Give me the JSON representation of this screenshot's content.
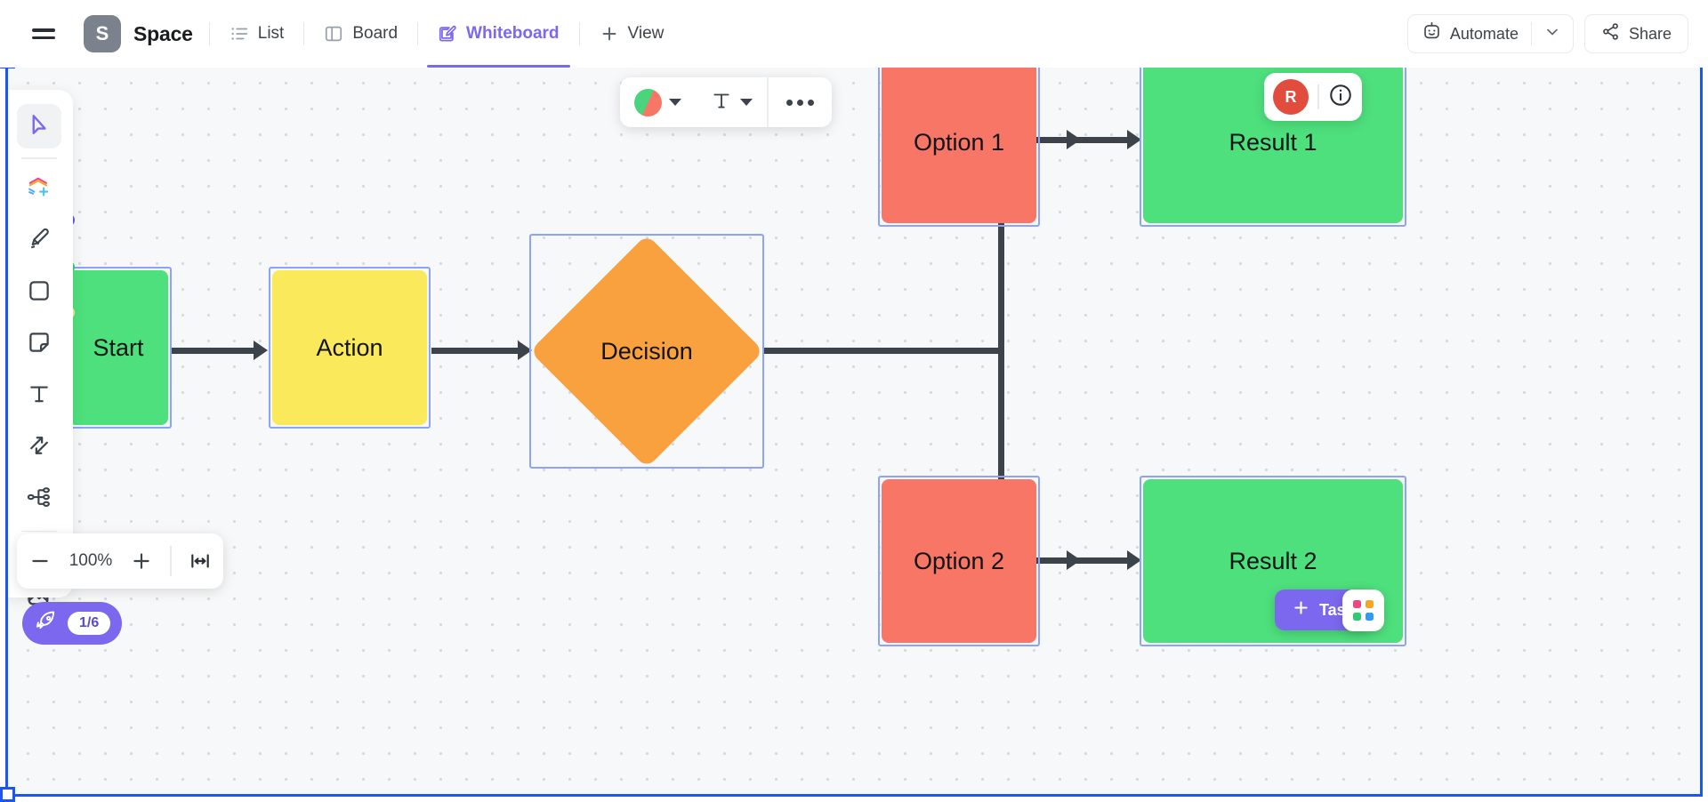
{
  "header": {
    "menu_icon": "hamburger-icon",
    "space_initial": "S",
    "space_name": "Space",
    "tabs": [
      {
        "label": "List",
        "icon": "list-icon",
        "active": false
      },
      {
        "label": "Board",
        "icon": "board-icon",
        "active": false
      },
      {
        "label": "Whiteboard",
        "icon": "whiteboard-icon",
        "active": true
      },
      {
        "label": "View",
        "icon": "plus-icon",
        "active": false
      }
    ],
    "automate_label": "Automate",
    "automate_icon": "robot-icon",
    "automate_caret_icon": "chevron-down-icon",
    "share_label": "Share",
    "share_icon": "share-icon"
  },
  "toolbar": {
    "tools": [
      {
        "name": "select-tool",
        "icon": "cursor-icon",
        "selected": true
      },
      {
        "name": "shapes-add-tool",
        "icon": "layers-plus-icon",
        "selected": false
      },
      {
        "name": "pen-tool",
        "icon": "highlighter-icon",
        "selected": false
      },
      {
        "name": "rectangle-tool",
        "icon": "square-icon",
        "selected": false
      },
      {
        "name": "sticky-note-tool",
        "icon": "sticky-note-icon",
        "selected": false
      },
      {
        "name": "text-tool",
        "icon": "text-t-icon",
        "selected": false
      },
      {
        "name": "connector-tool",
        "icon": "arrows-icon",
        "selected": false
      },
      {
        "name": "mindmap-tool",
        "icon": "mindmap-icon",
        "selected": false
      },
      {
        "name": "ai-tool",
        "icon": "magic-wand-icon",
        "selected": false
      }
    ],
    "image_tool_icon": "image-icon"
  },
  "format_toolbar": {
    "color_icon": "color-swatch-icon",
    "color_caret_icon": "chevron-down-icon",
    "text_icon": "text-format-icon",
    "text_caret_icon": "chevron-down-icon",
    "more_icon": "more-horizontal-icon"
  },
  "presence": {
    "avatar_initial": "R",
    "info_icon": "info-icon"
  },
  "zoom_controls": {
    "zoom_out_icon": "minus-icon",
    "zoom_level": "100%",
    "zoom_in_icon": "plus-icon",
    "fit_icon": "fit-to-screen-icon"
  },
  "onboarding": {
    "icon": "rocket-icon",
    "progress": "1/6"
  },
  "footer": {
    "task_label": "Task",
    "task_icon": "plus-icon",
    "apps_icon": "app-grid-icon"
  },
  "canvas": {
    "shapes": [
      {
        "id": "start",
        "label": "Start",
        "color": "#4ee07d",
        "type": "rounded-rect"
      },
      {
        "id": "action",
        "label": "Action",
        "color": "#fbe95c",
        "type": "rounded-rect"
      },
      {
        "id": "decision",
        "label": "Decision",
        "color": "#f9a03f",
        "type": "diamond"
      },
      {
        "id": "option1",
        "label": "Option 1",
        "color": "#f87666",
        "type": "rounded-rect"
      },
      {
        "id": "option2",
        "label": "Option 2",
        "color": "#f87666",
        "type": "rounded-rect"
      },
      {
        "id": "result1",
        "label": "Result 1",
        "color": "#4ee07d",
        "type": "rounded-rect"
      },
      {
        "id": "result2",
        "label": "Result 2",
        "color": "#4ee07d",
        "type": "rounded-rect"
      }
    ],
    "edge_dots": [
      "#5b5bd6",
      "#2ecc71",
      "#f6e3a1"
    ],
    "selection_color": "#1a56f0",
    "shape_selection_color": "#8ba4f9"
  }
}
